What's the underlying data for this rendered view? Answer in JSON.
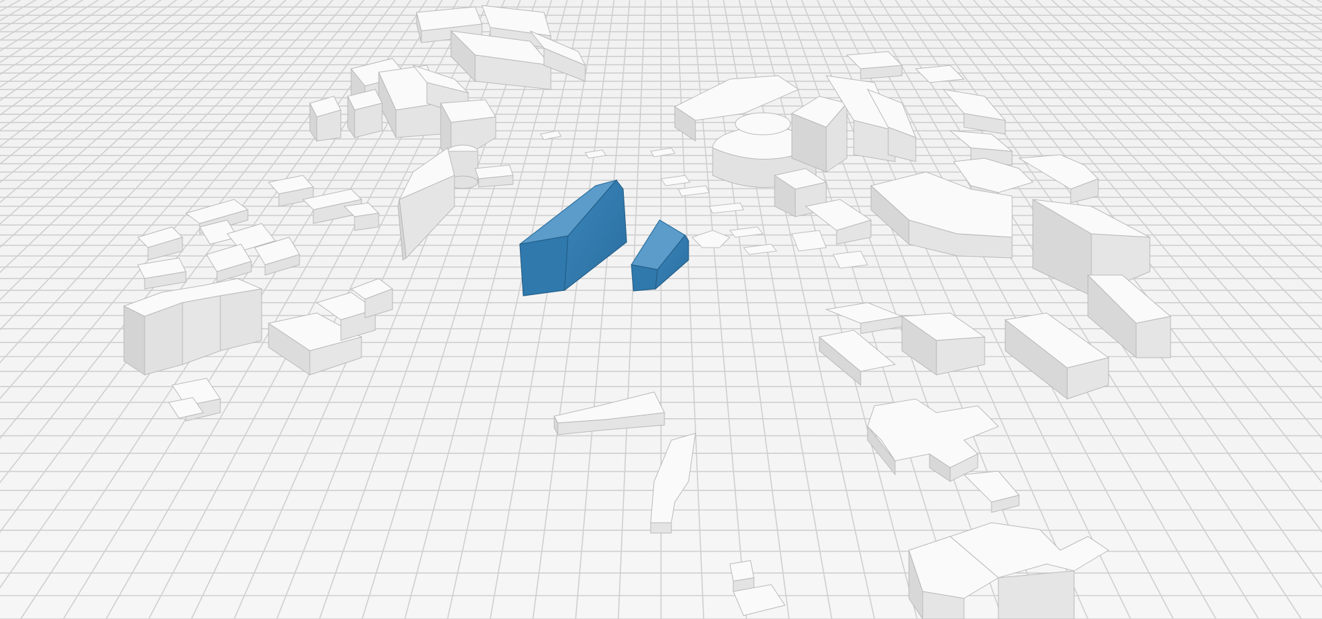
{
  "scene": {
    "kind": "3d-urban-massing-model",
    "ground": "grid",
    "highlight_color": "#2f79ad",
    "context_color": "#f4f4f4",
    "grid_color": "#cfcfcf"
  }
}
